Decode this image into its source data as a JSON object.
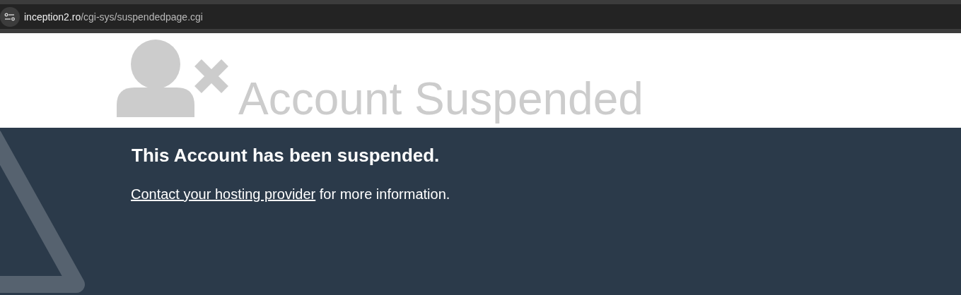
{
  "address_bar": {
    "host": "inception2.ro",
    "path": "/cgi-sys/suspendedpage.cgi"
  },
  "header": {
    "title": "Account Suspended"
  },
  "message": {
    "heading": "This Account has been suspended.",
    "link": "Contact your hosting provider",
    "text": " for more information."
  }
}
